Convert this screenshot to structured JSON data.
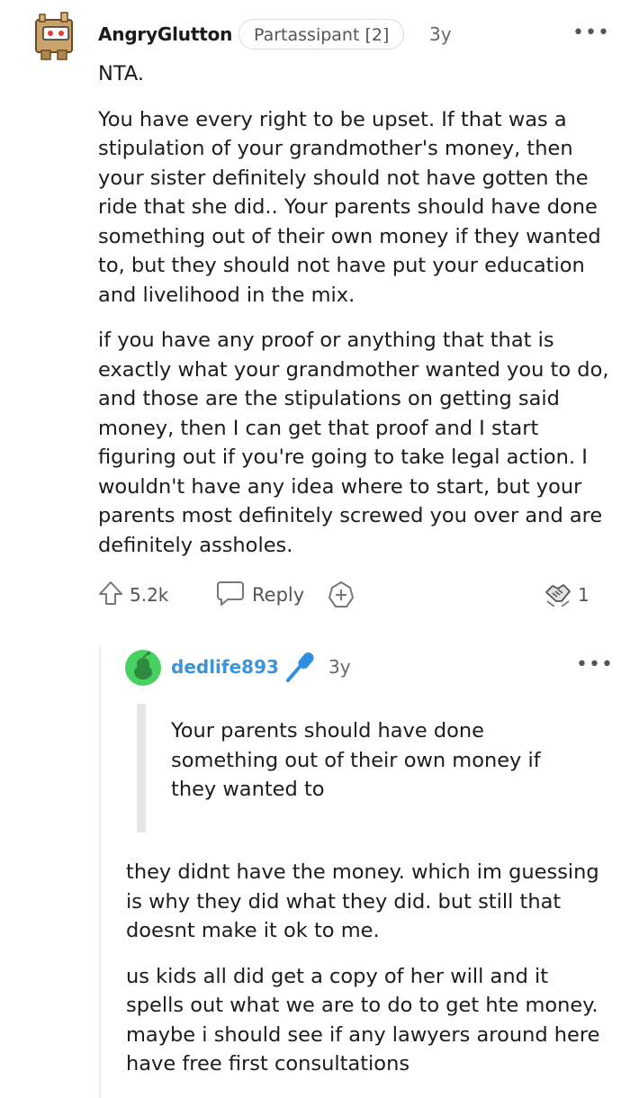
{
  "comment": {
    "username": "AngryGlutton",
    "flair": "Partassipant [2]",
    "age": "3y",
    "more": "•••",
    "paragraphs": [
      "NTA.",
      "You have every right to be upset. If that was a stipulation of your grandmother's money, then your sister definitely should not have gotten the ride that she did.. Your parents should have done something out of their own money if they wanted to, but they should not have put your education and livelihood in the mix.",
      "if you have any proof or anything that that is exactly what your grandmother wanted you to do, and those are the stipulations on getting said money, then I can get that proof and I start figuring out if you're going to take legal action. I wouldn't have any idea where to start, but your parents most definitely screwed you over and are definitely assholes."
    ],
    "actions": {
      "upvote_icon": "upvote-arrow-icon",
      "score": "5.2k",
      "reply_icon": "speech-bubble-icon",
      "reply_label": "Reply",
      "award_icon": "plus-circle-icon",
      "award_badge_icon": "handshake-award-icon",
      "award_count": "1"
    }
  },
  "reply": {
    "username": "dedlife893",
    "badge_icon": "microphone-icon",
    "age": "3y",
    "more": "•••",
    "quote": "Your parents should have done something out of their own money if they wanted to",
    "paragraphs": [
      "they didnt have the money. which im guessing is why they did what they did. but still that doesnt make it ok to me.",
      "us kids all did get a copy of her will and it spells out what we are to do to get hte money. maybe i should see if any lawyers around here have free first consultations"
    ]
  },
  "colors": {
    "username_reply": "#3b93d9",
    "avatar_reply_bg": "#46d160",
    "thread_line": "#edeff1",
    "quote_bar": "#e4e6e8"
  }
}
